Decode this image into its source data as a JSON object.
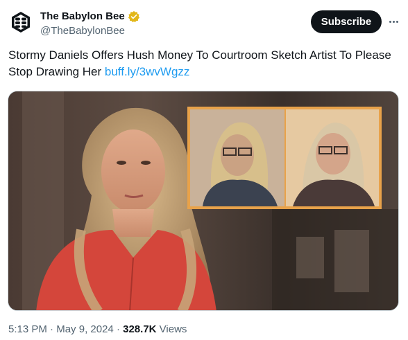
{
  "account": {
    "display_name": "The Babylon Bee",
    "handle": "@TheBabylonBee",
    "verified_badge": "verified-badge-icon",
    "verified_color": "#e2b719"
  },
  "actions": {
    "subscribe_label": "Subscribe",
    "more_icon": "more-icon"
  },
  "tweet": {
    "text": "Stormy Daniels Offers Hush Money To Courtroom Sketch Artist To Please Stop Drawing Her ",
    "link_text": "buff.ly/3wvWgzz",
    "link_color": "#1d9bf0"
  },
  "meta": {
    "time": "5:13 PM",
    "separator": "·",
    "date": "May 9, 2024",
    "views_count": "328.7K",
    "views_label": "Views"
  }
}
